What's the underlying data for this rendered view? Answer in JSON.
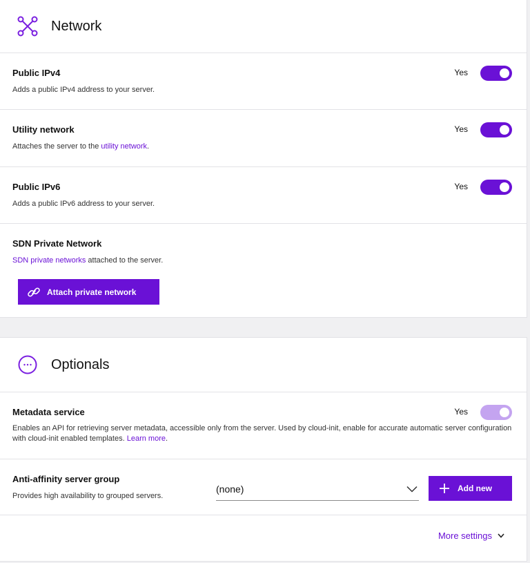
{
  "network": {
    "title": "Network",
    "icon": "network-nodes-icon",
    "public_ipv4": {
      "title": "Public IPv4",
      "description": "Adds a public IPv4 address to your server.",
      "value_label": "Yes"
    },
    "utility_network": {
      "title": "Utility network",
      "description_prefix": "Attaches the server to the ",
      "description_link": "utility network",
      "description_suffix": ".",
      "value_label": "Yes"
    },
    "public_ipv6": {
      "title": "Public IPv6",
      "description": "Adds a public IPv6 address to your server.",
      "value_label": "Yes"
    },
    "sdn": {
      "title": "SDN Private Network",
      "description_link": "SDN private networks",
      "description_suffix": " attached to the server.",
      "button_label": "Attach private network"
    }
  },
  "optionals": {
    "title": "Optionals",
    "icon": "more-circle-icon",
    "metadata_service": {
      "title": "Metadata service",
      "description": "Enables an API for retrieving server metadata, accessible only from the server. Used by cloud-init, enable for accurate automatic server configuration with cloud-init enabled templates. ",
      "description_link": "Learn more",
      "description_suffix": ".",
      "value_label": "Yes"
    },
    "anti_affinity": {
      "title": "Anti-affinity server group",
      "description": "Provides high availability to grouped servers.",
      "selected_value": "(none)",
      "add_button_label": "Add new"
    },
    "more_settings_label": "More settings"
  },
  "colors": {
    "accent": "#6a11d6",
    "accent_disabled": "#c4a4f0"
  }
}
